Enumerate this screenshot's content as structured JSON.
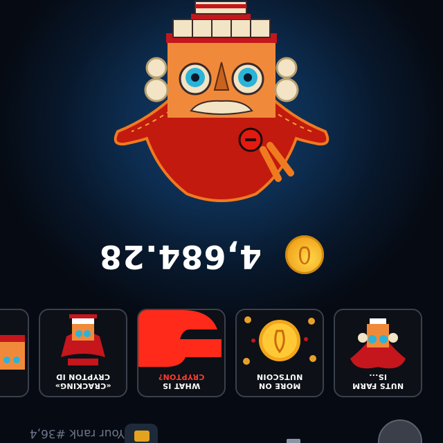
{
  "player": {
    "rank_text": "Your rank #36,4",
    "balance": "4,684.28"
  },
  "cards": [
    {
      "id": "nuts-farm",
      "lines": [
        "NUTS FARM",
        "IS..."
      ],
      "art": "nutcracker-icon"
    },
    {
      "id": "more-on-nutscoin",
      "lines": [
        "MORE ON",
        "NUTSCOIN"
      ],
      "art": "coin-icon"
    },
    {
      "id": "what-is-crypton",
      "lines": [
        "WHAT IS",
        "CRYPTON?"
      ],
      "art": "crypton-logo-icon"
    },
    {
      "id": "cracking-crypton-id",
      "lines": [
        "«CRACKING»",
        "CRYPTON ID"
      ],
      "art": "nutcracker-icon"
    }
  ],
  "colors": {
    "accent_red": "#ff3b30",
    "coin_gold": "#f0a21a",
    "background": "#070b12"
  }
}
